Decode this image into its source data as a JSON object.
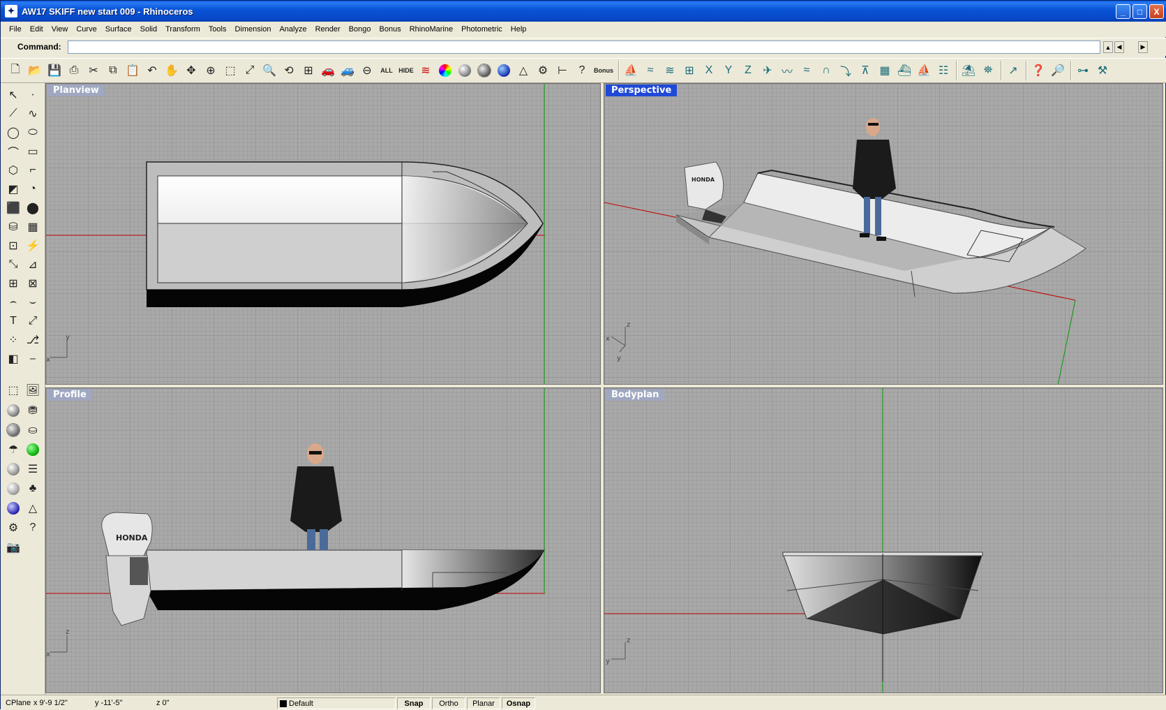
{
  "window": {
    "title": "AW17 SKIFF new start 009 - Rhinoceros",
    "controls": [
      "_",
      "□",
      "X"
    ]
  },
  "menu": [
    "File",
    "Edit",
    "View",
    "Curve",
    "Surface",
    "Solid",
    "Transform",
    "Tools",
    "Dimension",
    "Analyze",
    "Render",
    "Bongo",
    "Bonus",
    "RhinoMarine",
    "Photometric",
    "Help"
  ],
  "command": {
    "label": "Command:",
    "value": ""
  },
  "toolbar": {
    "all_label": "ALL",
    "hide_label": "HIDE",
    "bonus_label": "Bonus"
  },
  "viewports": {
    "top_left": {
      "title": "Planview",
      "axis_x": "x",
      "axis_y": "y"
    },
    "top_right": {
      "title": "Perspective",
      "axis_x": "x",
      "axis_y": "y",
      "axis_z": "z"
    },
    "bottom_left": {
      "title": "Profile",
      "axis_x": "x",
      "axis_z": "z"
    },
    "bottom_right": {
      "title": "Bodyplan",
      "axis_y": "y",
      "axis_z": "z"
    }
  },
  "objects": {
    "engine_brand": "HONDA"
  },
  "status": {
    "cplane": "CPlane",
    "x": "x 9'-9 1/2\"",
    "y": "y -11'-5\"",
    "z": "z 0\"",
    "layer": "Default",
    "snap": "Snap",
    "ortho": "Ortho",
    "planar": "Planar",
    "osnap": "Osnap"
  },
  "colors": {
    "active_viewport": "#1f49d6",
    "inactive_viewport": "#a0a8c0",
    "x_axis": "#c00000",
    "y_axis": "#00a000"
  }
}
